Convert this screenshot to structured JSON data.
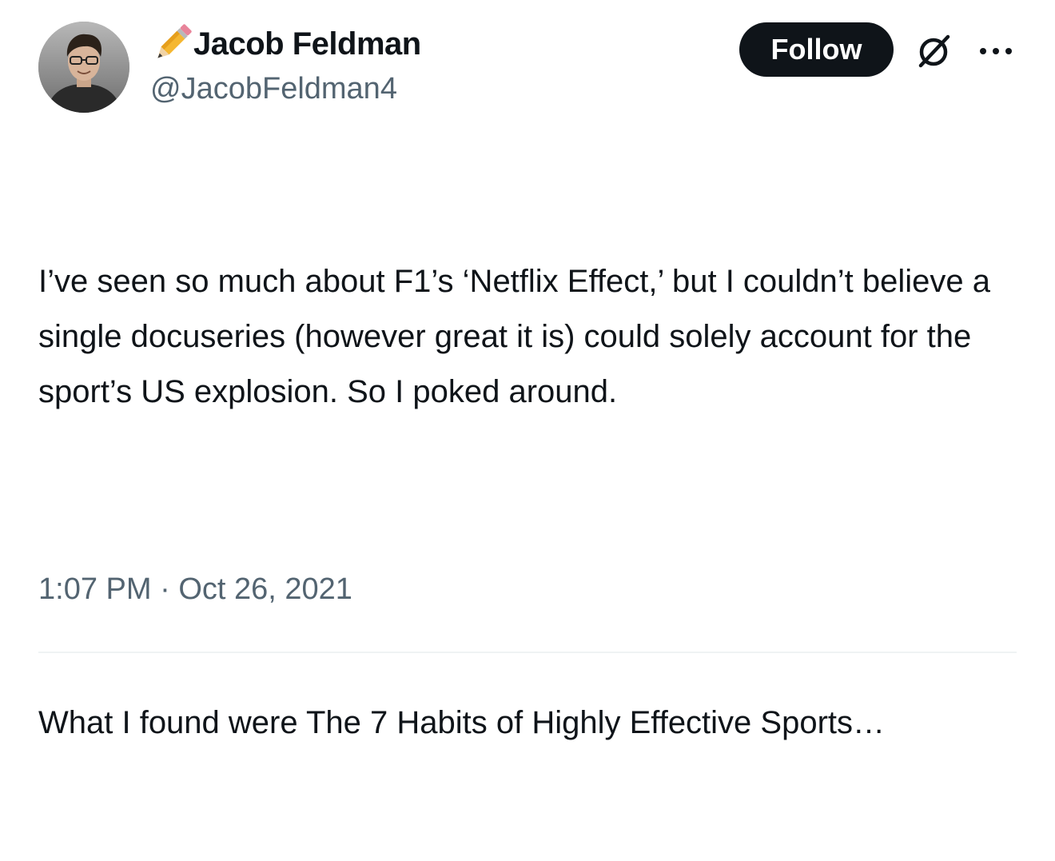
{
  "author": {
    "name": "Jacob Feldman",
    "handle": "@JacobFeldman4",
    "name_emoji_icon": "pencil-icon"
  },
  "actions": {
    "follow_label": "Follow",
    "grok_icon": "grok-icon",
    "more_icon": "more-icon"
  },
  "tweet": {
    "paragraph_1": "I’ve seen so much about F1’s ‘Netflix Effect,’ but I couldn’t believe a single docuseries (however great it is) could solely account for the sport’s US explosion. So I poked around.",
    "paragraph_2": "What I found were The 7 Habits of Highly Effective Sports…"
  },
  "meta": {
    "time": "1:07 PM",
    "separator": "·",
    "date": "Oct 26, 2021"
  },
  "colors": {
    "text_primary": "#0f1419",
    "text_secondary": "#536471",
    "button_bg": "#0f1419",
    "divider": "#eff3f4"
  }
}
